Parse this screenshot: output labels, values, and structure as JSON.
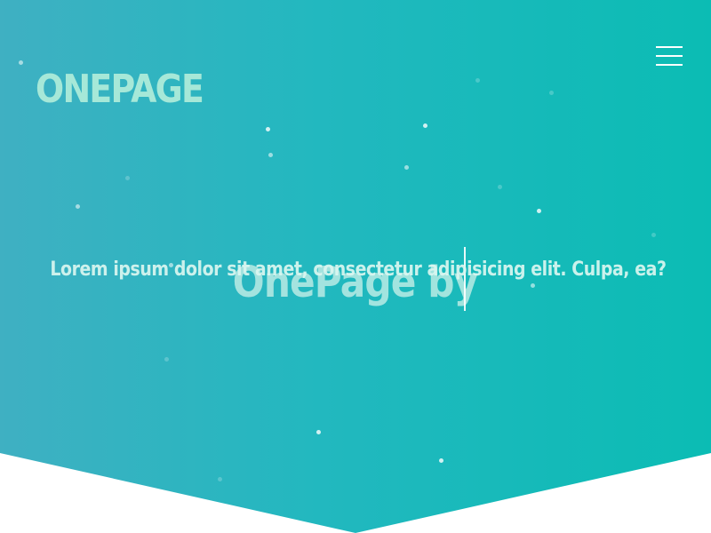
{
  "brand": {
    "logo_text": "ONEPAGE",
    "logo_color": "#a6e8d8"
  },
  "header": {
    "menu_icon": "hamburger-menu-icon"
  },
  "hero": {
    "headline": "OnePage by",
    "subtitle": "Lorem ipsum dolor sit amet, consectetur adipisicing elit. Culpa, ea?",
    "gradient_start": "#3fb0c2",
    "gradient_end": "#0bbcb4"
  }
}
